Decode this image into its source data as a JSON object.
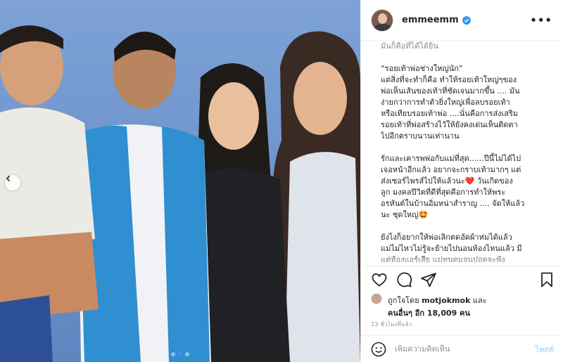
{
  "post": {
    "username": "emmeemm",
    "verified": true,
    "caption_lines": [
      {
        "text": "มันก็คือที่ได้ได้ยิน",
        "faded": true
      },
      {
        "text": "",
        "faded": false
      },
      {
        "text": "“รอยเท้าพ่อช่างใหญ่นัก”",
        "faded": false
      },
      {
        "text": "แต่สิ่งที่จะทำก็คือ ทำให้รอยเท้าใหญ่ๆของ",
        "faded": false
      },
      {
        "text": "พ่อเห็นเส้นของเท้าที่ชัดเจนมากขึ้น .... มัน",
        "faded": false
      },
      {
        "text": "ง่ายกว่าการทำตัวยิ่งใหญ่เพื่อลบรอยเท้า",
        "faded": false
      },
      {
        "text": "หรือเทียบรอยเท้าพ่อ ....นั่นคือการส่งเสริม",
        "faded": false
      },
      {
        "text": "รอยเท้าที่พ่อสร้างไว้ให้ยังคงเด่นเห็นติดตา",
        "faded": false
      },
      {
        "text": "ไปอีกตราบนานเท่านาน",
        "faded": false
      },
      {
        "text": "",
        "faded": false
      },
      {
        "text": "รักและเคารพพ่อกับแม่ที่สุด......ปีนี้ไม่ได้ไป",
        "faded": false
      },
      {
        "text": "เจอหน้าอีกแล้ว อยากจะกราบเท้ามากๆ แต่",
        "faded": false
      },
      {
        "text": "ส่งเซอร์ไพรส์ไปให้แล้วนะ❤️ วันเกิดของ",
        "faded": false
      },
      {
        "text": "ลูก มงคลปีวิตที่ดีที่สุดคือการทำให้พระ",
        "faded": false
      },
      {
        "text": "อรหันต์ในบ้านอิ่มหน่าสำราญ .... จัดให้แล้ว",
        "faded": false
      },
      {
        "text": "นะ ชุดใหญ่🤩",
        "faded": false
      },
      {
        "text": "",
        "faded": false
      },
      {
        "text": "ยังไงก็อยากให้พ่อเลิกตดอัดผ้าห่มได้แล้ว",
        "faded": false
      },
      {
        "text": "แม่ไม่ไหวไม่รู้จะย้ายไปนอนห้องไหนแล้ว มี",
        "faded": false
      },
      {
        "text": "แต่ห้องแอร์เสีย แม่ทนดมจนปอดจะพัง",
        "faded": false
      },
      {
        "text": "",
        "faded": true
      }
    ],
    "likes": {
      "prefix": "ถูกใจโดย",
      "user": "motjokmok",
      "conj": "และ",
      "others_label": "คนอื่นๆ อีก 18,009 คน"
    },
    "timestamp": "23 ชั่วโมงที่แล้ว",
    "comment": {
      "placeholder": "เพิ่มความคิดเห็น",
      "post_label": "โพสต์"
    },
    "carousel": {
      "slides": 3,
      "active": 2
    },
    "colors": {
      "accent": "#3897f0",
      "heart": "#ed4956",
      "post_disabled": "#b2dffc",
      "muted": "#8e8e8e",
      "photo_wall": "#6f93c9"
    }
  }
}
